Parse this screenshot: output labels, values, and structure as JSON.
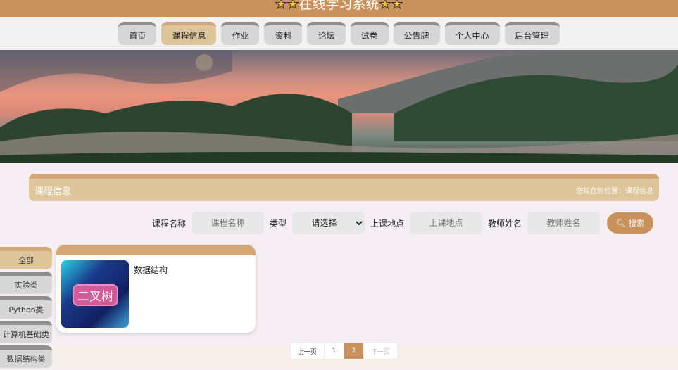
{
  "header": {
    "title": "在线学习系统",
    "star": "★"
  },
  "nav": [
    {
      "label": "首页"
    },
    {
      "label": "课程信息",
      "active": true
    },
    {
      "label": "作业"
    },
    {
      "label": "资料"
    },
    {
      "label": "论坛"
    },
    {
      "label": "试卷"
    },
    {
      "label": "公告牌"
    },
    {
      "label": "个人中心"
    },
    {
      "label": "后台管理"
    }
  ],
  "section": {
    "title": "课程信息",
    "breadcrumb": "您现在的位置：课程信息"
  },
  "search": {
    "name_label": "课程名称",
    "name_placeholder": "课程名称",
    "type_label": "类型",
    "type_value": "请选择",
    "location_label": "上课地点",
    "location_placeholder": "上课地点",
    "teacher_label": "教师姓名",
    "teacher_placeholder": "教师姓名",
    "button": "搜索"
  },
  "sidebar": [
    {
      "label": "全部"
    },
    {
      "label": "实验类"
    },
    {
      "label": "Python类"
    },
    {
      "label": "计算机基础类"
    },
    {
      "label": "数据结构类"
    }
  ],
  "courses": [
    {
      "name": "数据结构",
      "image_text": "二叉树"
    }
  ],
  "pagination": {
    "prev": "上一页",
    "pages": [
      "1",
      "2"
    ],
    "current": "2",
    "next": "下一页"
  }
}
